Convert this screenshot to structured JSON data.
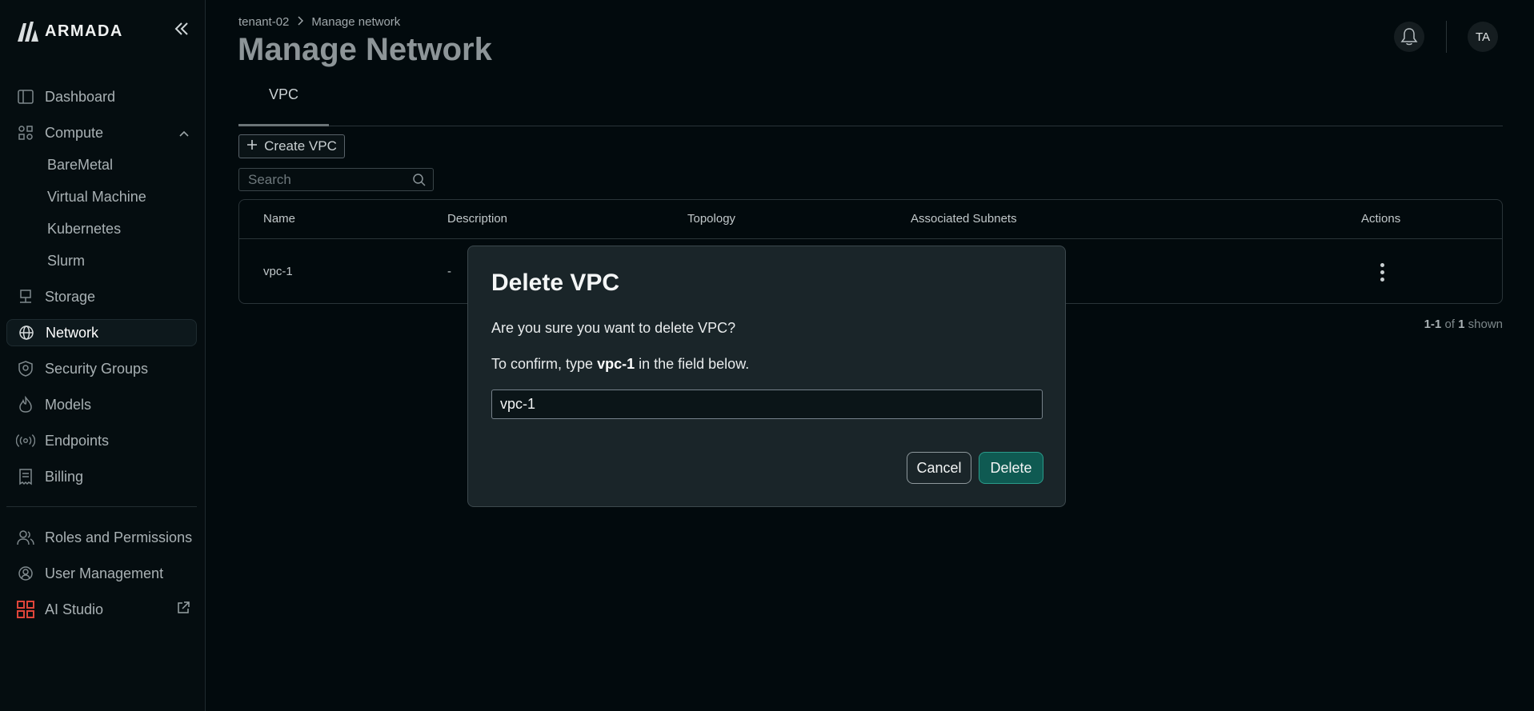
{
  "brand": {
    "name": "ARMADA"
  },
  "sidebar": {
    "collapse_icon": "double-chevron-left-icon",
    "items": [
      {
        "label": "Dashboard",
        "icon": "panel-icon"
      },
      {
        "label": "Compute",
        "icon": "compute-icon",
        "expanded": true,
        "children": [
          "BareMetal",
          "Virtual Machine",
          "Kubernetes",
          "Slurm"
        ]
      },
      {
        "label": "Storage",
        "icon": "storage-icon"
      },
      {
        "label": "Network",
        "icon": "globe-icon",
        "active": true
      },
      {
        "label": "Security Groups",
        "icon": "shield-icon"
      },
      {
        "label": "Models",
        "icon": "flame-icon"
      },
      {
        "label": "Endpoints",
        "icon": "broadcast-icon"
      },
      {
        "label": "Billing",
        "icon": "receipt-icon"
      }
    ],
    "bottom_items": [
      {
        "label": "Roles and Permissions",
        "icon": "users-icon"
      },
      {
        "label": "User Management",
        "icon": "user-gear-icon"
      },
      {
        "label": "AI Studio",
        "icon": "grid-icon",
        "external": true
      }
    ]
  },
  "header": {
    "breadcrumb": [
      "tenant-02",
      "Manage network"
    ],
    "title": "Manage Network",
    "avatar_initials": "TA"
  },
  "tabs": [
    "VPC"
  ],
  "toolbar": {
    "create_label": "Create VPC",
    "search_placeholder": "Search"
  },
  "table": {
    "columns": [
      "Name",
      "Description",
      "Topology",
      "Associated Subnets",
      "Actions"
    ],
    "rows": [
      {
        "name": "vpc-1",
        "description": "-"
      }
    ]
  },
  "pager": {
    "range": "1-1",
    "of": "of",
    "total": "1",
    "suffix": "shown"
  },
  "dialog": {
    "title": "Delete VPC",
    "message": "Are you sure you want to delete VPC?",
    "confirm_prefix": "To confirm, type",
    "confirm_name": "vpc-1",
    "confirm_suffix": "in the field below.",
    "input_value": "vpc-1",
    "cancel_label": "Cancel",
    "delete_label": "Delete"
  },
  "colors": {
    "background": "#020a0d",
    "accent": "#0f5a52",
    "dialog": "#1a2529",
    "logo_grid": "#e0453a"
  }
}
